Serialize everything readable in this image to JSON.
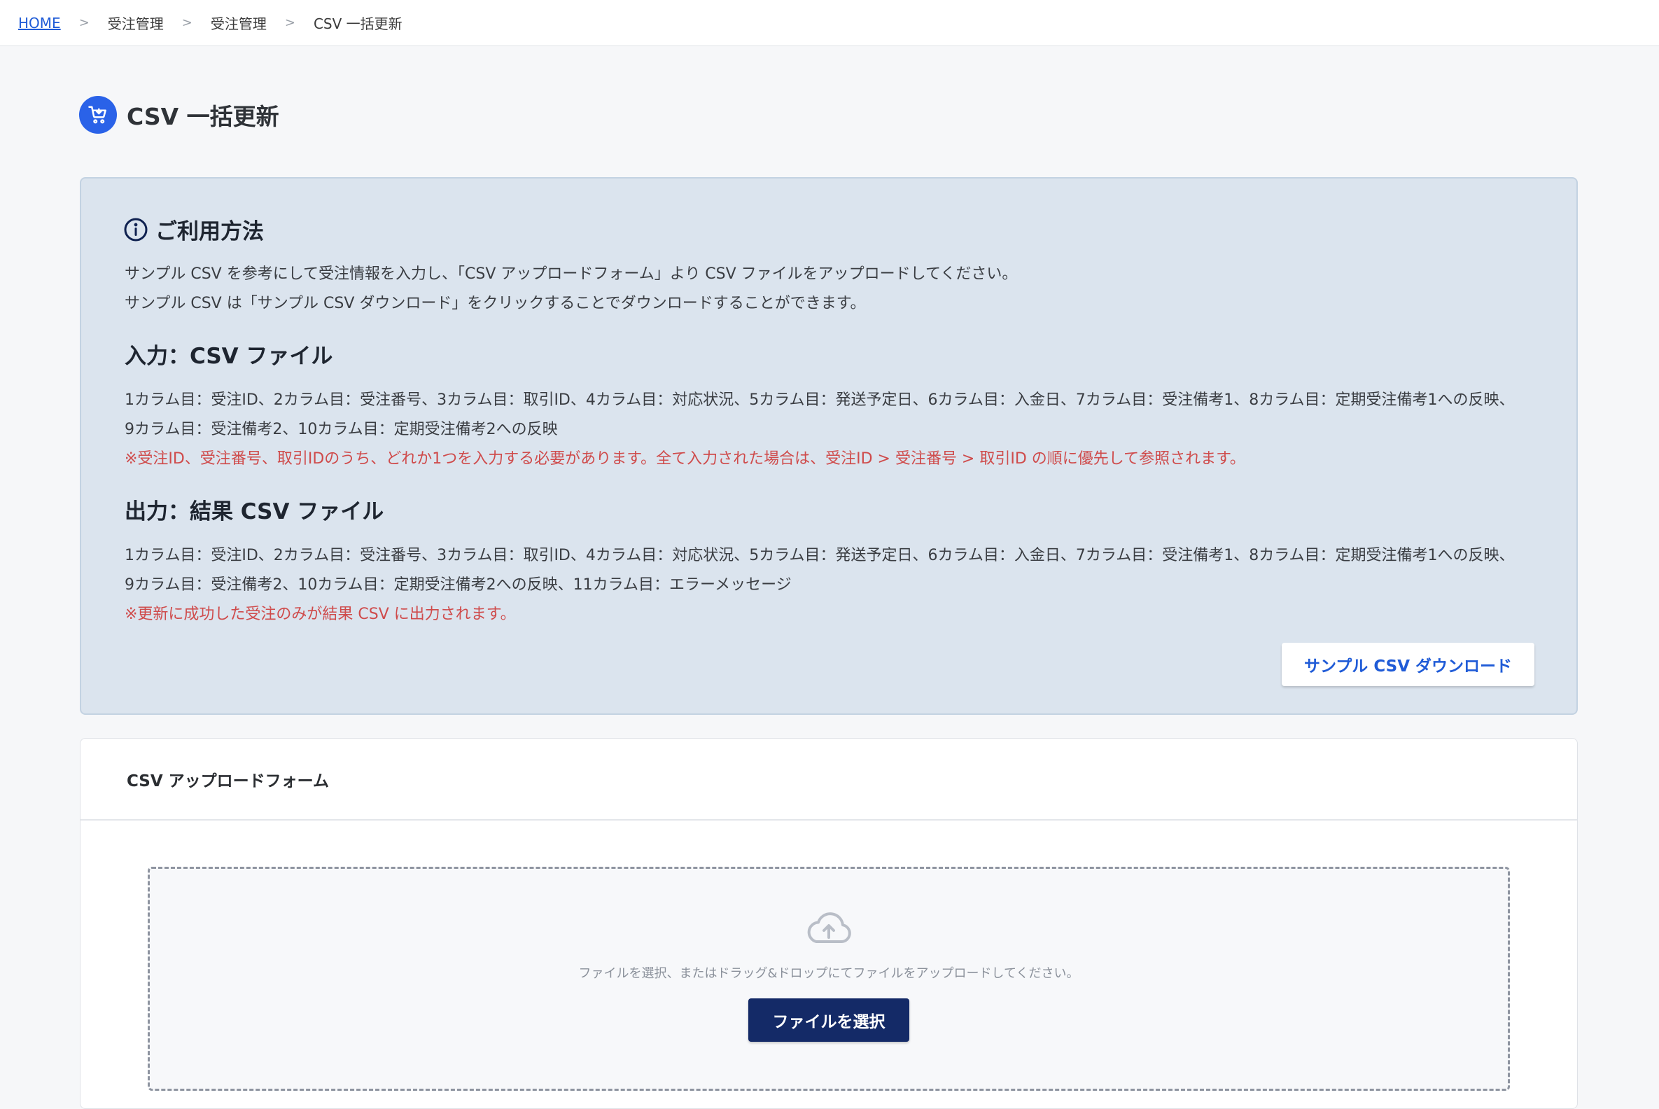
{
  "breadcrumb": {
    "home": "HOME",
    "separator": ">",
    "items": [
      "受注管理",
      "受注管理",
      "CSV 一括更新"
    ]
  },
  "page": {
    "title": "CSV 一括更新",
    "icon": "cart-icon"
  },
  "usage": {
    "heading": "ご利用方法",
    "intro_line1": "サンプル CSV を参考にして受注情報を入力し、「CSV アップロードフォーム」より CSV ファイルをアップロードしてください。",
    "intro_line2": "サンプル CSV は「サンプル CSV ダウンロード」をクリックすることでダウンロードすることができます。",
    "input": {
      "heading": "入力：CSV ファイル",
      "line1": "1カラム目：受注ID、2カラム目：受注番号、3カラム目：取引ID、4カラム目：対応状況、5カラム目：発送予定日、6カラム目：入金日、7カラム目：受注備考1、8カラム目：定期受注備考1への反映、",
      "line2": "9カラム目：受注備考2、10カラム目：定期受注備考2への反映",
      "note": "※受注ID、受注番号、取引IDのうち、どれか1つを入力する必要があります。全て入力された場合は、受注ID > 受注番号 > 取引ID の順に優先して参照されます。"
    },
    "output": {
      "heading": "出力：結果 CSV ファイル",
      "line1": "1カラム目：受注ID、2カラム目：受注番号、3カラム目：取引ID、4カラム目：対応状況、5カラム目：発送予定日、6カラム目：入金日、7カラム目：受注備考1、8カラム目：定期受注備考1への反映、",
      "line2": "9カラム目：受注備考2、10カラム目：定期受注備考2への反映、11カラム目：エラーメッセージ",
      "note": "※更新に成功した受注のみが結果 CSV に出力されます。"
    },
    "sample_button": "サンプル CSV ダウンロード"
  },
  "upload": {
    "title": "CSV アップロードフォーム",
    "drop_text": "ファイルを選択、またはドラッグ&ドロップにてファイルをアップロードしてください。",
    "select_button": "ファイルを選択"
  },
  "colors": {
    "accent": "#2a62e8",
    "link": "#1f5bd7",
    "primary_button": "#142a67",
    "note_red": "#cf4b4b",
    "info_bg": "#dbe4ee"
  }
}
